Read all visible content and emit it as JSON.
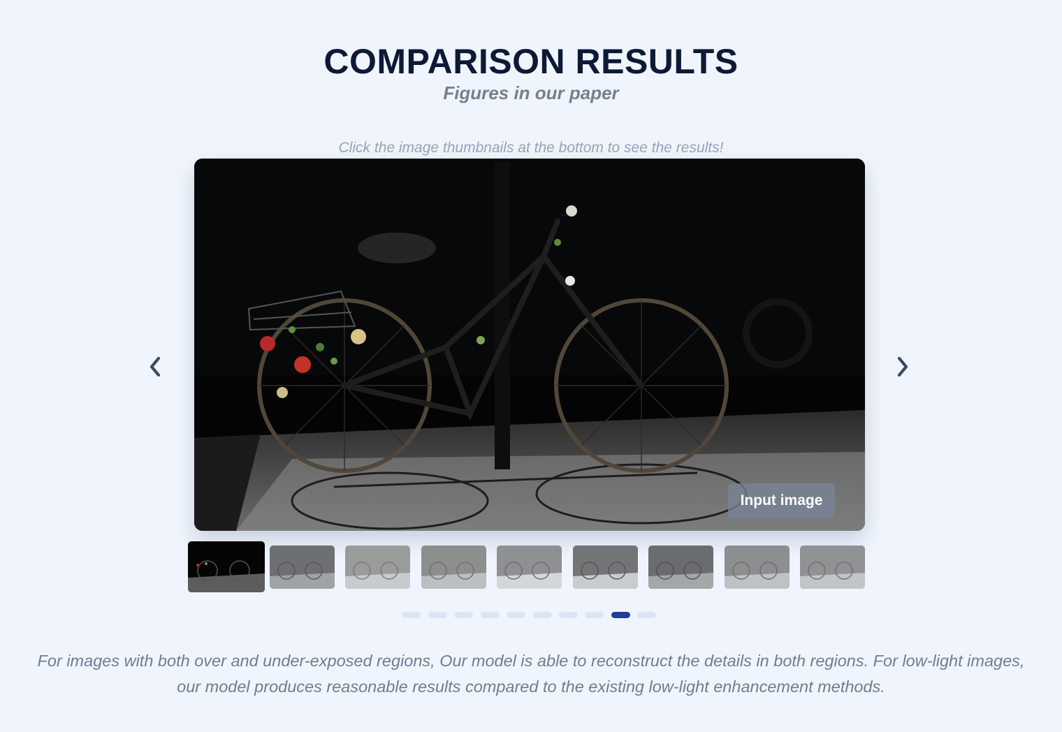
{
  "header": {
    "title": "COMPARISON RESULTS",
    "subtitle": "Figures in our paper"
  },
  "viewer": {
    "hint": "Click the image thumbnails at the bottom to see the results!",
    "image_label": "Input image",
    "prev_icon": "chevron-left-icon",
    "next_icon": "chevron-right-icon",
    "thumbnail_count": 9,
    "active_thumbnail": 1,
    "dot_count": 10,
    "active_dot": 9
  },
  "footer": {
    "caption": "For images with both over and under-exposed regions, Our model is able to reconstruct the details in both regions. For low-light images, our model produces reasonable results compared to the existing low-light enhancement methods."
  },
  "colors": {
    "background": "#f0f5fd",
    "title": "#0c1a36",
    "accent": "#1c3f9e"
  }
}
